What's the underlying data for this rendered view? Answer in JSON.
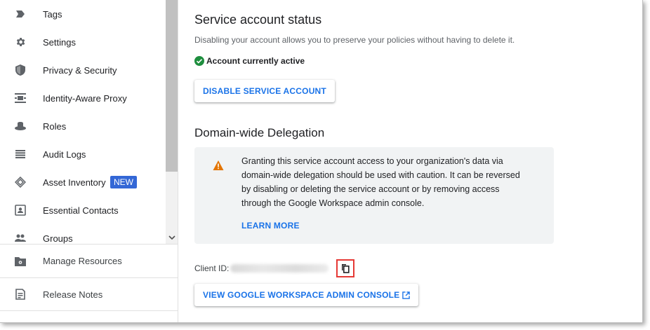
{
  "sidebar": {
    "items": [
      {
        "label": "Tags",
        "icon": "tag-icon"
      },
      {
        "label": "Settings",
        "icon": "gear-icon"
      },
      {
        "label": "Privacy & Security",
        "icon": "shield-icon"
      },
      {
        "label": "Identity-Aware Proxy",
        "icon": "proxy-icon"
      },
      {
        "label": "Roles",
        "icon": "hat-icon"
      },
      {
        "label": "Audit Logs",
        "icon": "list-icon"
      },
      {
        "label": "Asset Inventory",
        "icon": "asset-inventory-icon",
        "badge": "NEW"
      },
      {
        "label": "Essential Contacts",
        "icon": "contact-card-icon"
      },
      {
        "label": "Groups",
        "icon": "people-icon"
      }
    ],
    "bottom_items": [
      {
        "label": "Manage Resources",
        "icon": "folder-gear-icon"
      },
      {
        "label": "Release Notes",
        "icon": "notes-icon"
      }
    ]
  },
  "main": {
    "status_title": "Service account status",
    "status_description": "Disabling your account allows you to preserve your policies without having to delete it.",
    "status_text": "Account currently active",
    "disable_button": "DISABLE SERVICE ACCOUNT",
    "delegation_title": "Domain-wide Delegation",
    "callout_text": "Granting this service account access to your organization's data via domain-wide delegation should be used with caution. It can be reversed by disabling or deleting the service account or by removing access through the Google Workspace admin console.",
    "learn_more": "LEARN MORE",
    "client_id_label": "Client ID:",
    "admin_console_button": "VIEW GOOGLE WORKSPACE ADMIN CONSOLE"
  },
  "colors": {
    "accent": "#1a73e8",
    "badge": "#3367d6",
    "success": "#1e8e3e",
    "warning": "#e37400",
    "highlight": "#e53935"
  }
}
